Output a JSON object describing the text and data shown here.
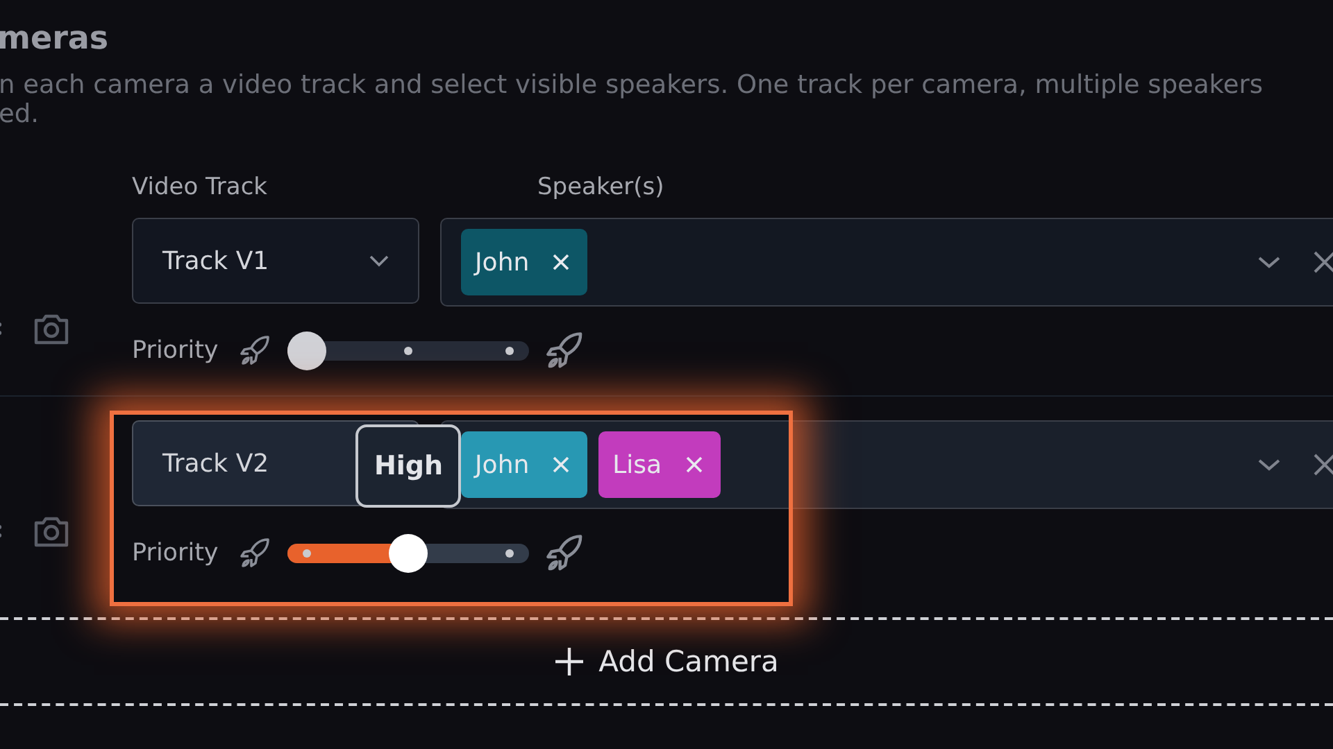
{
  "section": {
    "title": "meras",
    "description_lines": [
      "n each camera a video track and select visible speakers. One track per camera, multiple speakers",
      "ed."
    ]
  },
  "columns": {
    "video_track": "Video Track",
    "speakers": "Speaker(s)"
  },
  "cameras": [
    {
      "highlighted": false,
      "track": "Track V1",
      "speakers": [
        {
          "name": "John",
          "color": "#0d5666"
        }
      ],
      "priority_label": "Priority",
      "level": 0
    },
    {
      "highlighted": true,
      "track": "Track V2",
      "speakers": [
        {
          "name": "John",
          "color": "#2898b3"
        },
        {
          "name": "Lisa",
          "color": "#c23cbd"
        }
      ],
      "priority_label": "Priority",
      "level": 0.5,
      "tooltip": "High"
    }
  ],
  "add_button": {
    "label": "Add Camera"
  }
}
